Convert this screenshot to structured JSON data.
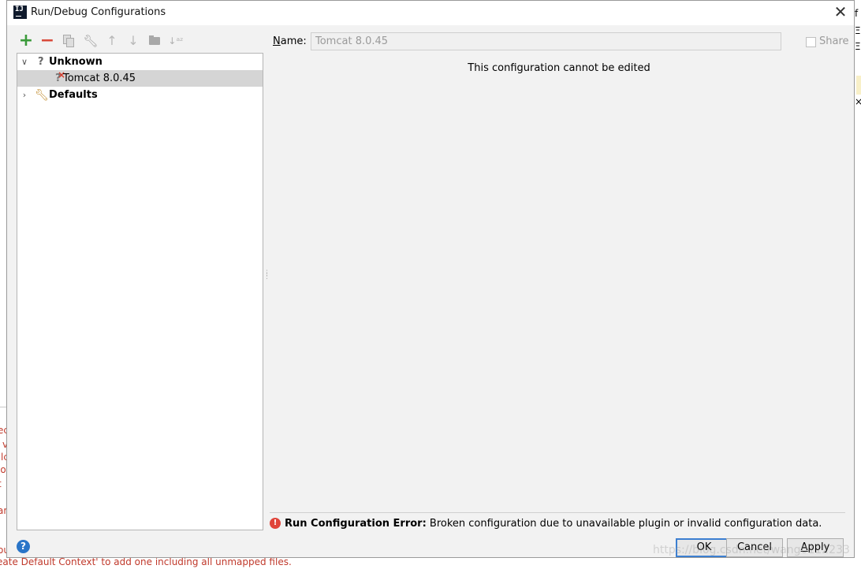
{
  "dialog": {
    "title": "Run/Debug Configurations",
    "app_icon_text": "IJ"
  },
  "toolbar": {
    "icons": [
      "add-icon",
      "remove-icon",
      "copy-icon",
      "wrench-icon",
      "move-up-icon",
      "move-down-icon",
      "folder-icon",
      "sort-icon"
    ]
  },
  "tree": {
    "items": [
      {
        "label": "Unknown",
        "icon": "question-icon",
        "expanded": true
      },
      {
        "label": "Tomcat 8.0.45",
        "icon": "broken-config-icon",
        "selected": true
      },
      {
        "label": "Defaults",
        "icon": "wrench-icon",
        "expanded": false
      }
    ]
  },
  "form": {
    "name_label_prefix": "N",
    "name_label_rest": "ame:",
    "name_value": "Tomcat 8.0.45",
    "share_label": "Share",
    "no_edit_message": "This configuration cannot be edited"
  },
  "error": {
    "title": "Run Configuration Error:",
    "message": "Broken configuration due to unavailable plugin or invalid configuration data."
  },
  "buttons": {
    "ok": "OK",
    "cancel": "Cancel",
    "apply_prefix": "A",
    "apply_rest": "pply"
  },
  "colors": {
    "add": "#3a9a3a",
    "remove": "#d94a3a",
    "error": "#e0443a",
    "ok_border": "#3c7fd1",
    "help": "#2a75c8"
  },
  "background": {
    "bottom_text": "eate Default Context' to add one including all unmapped files.",
    "left_fragments": [
      "ec",
      "v",
      "lc",
      "lo",
      "t",
      "ar",
      "ou"
    ],
    "right_fragments": [
      "f",
      "Ξ",
      "Ξ",
      "×"
    ],
    "watermark": "https://blog.csdn.net/wang0112233"
  }
}
